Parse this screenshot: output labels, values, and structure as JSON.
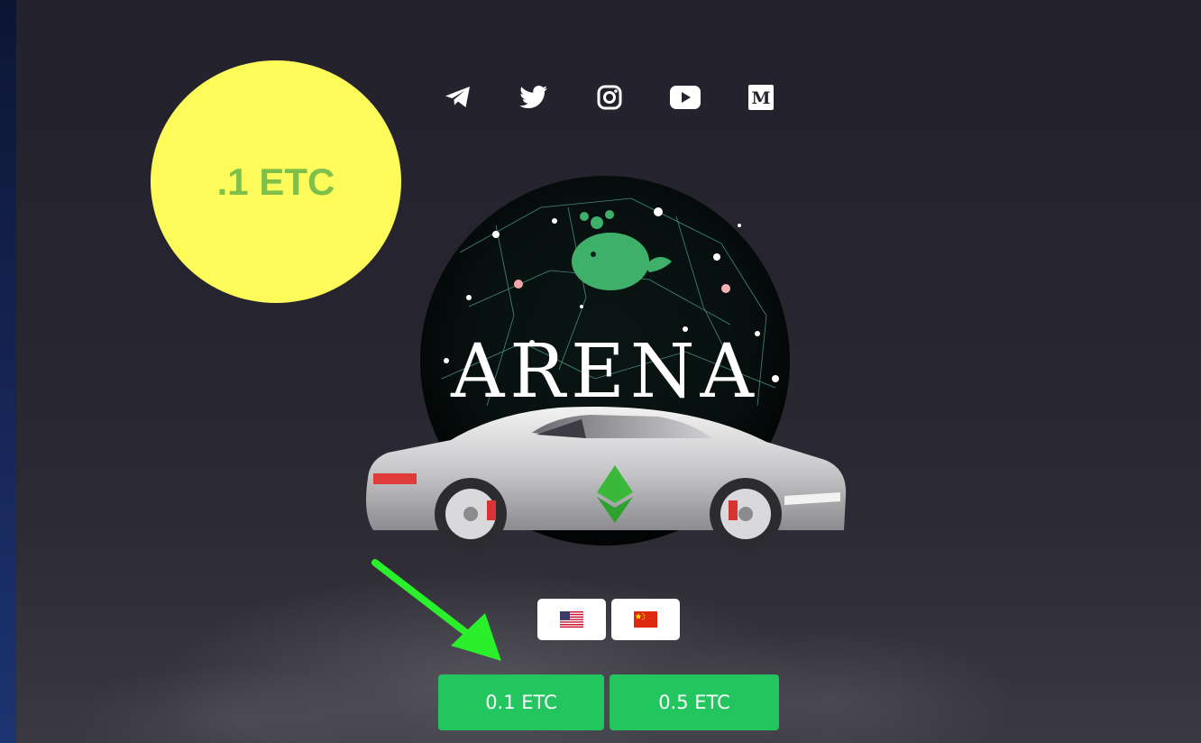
{
  "social": [
    {
      "icon": "telegram-icon"
    },
    {
      "icon": "twitter-icon"
    },
    {
      "icon": "instagram-icon"
    },
    {
      "icon": "youtube-icon"
    },
    {
      "icon": "medium-icon"
    }
  ],
  "badge": {
    "text": ".1 ETC",
    "color": "#fdfb5a",
    "text_color": "#7fbf4c"
  },
  "logo": {
    "text": "ARENA"
  },
  "languages": [
    {
      "icon": "us-flag-icon"
    },
    {
      "icon": "china-flag-icon"
    }
  ],
  "amounts": [
    {
      "label": "0.1 ETC"
    },
    {
      "label": "0.5 ETC"
    }
  ],
  "colors": {
    "accent_green": "#22c55e",
    "arrow_green": "#29f02a"
  }
}
